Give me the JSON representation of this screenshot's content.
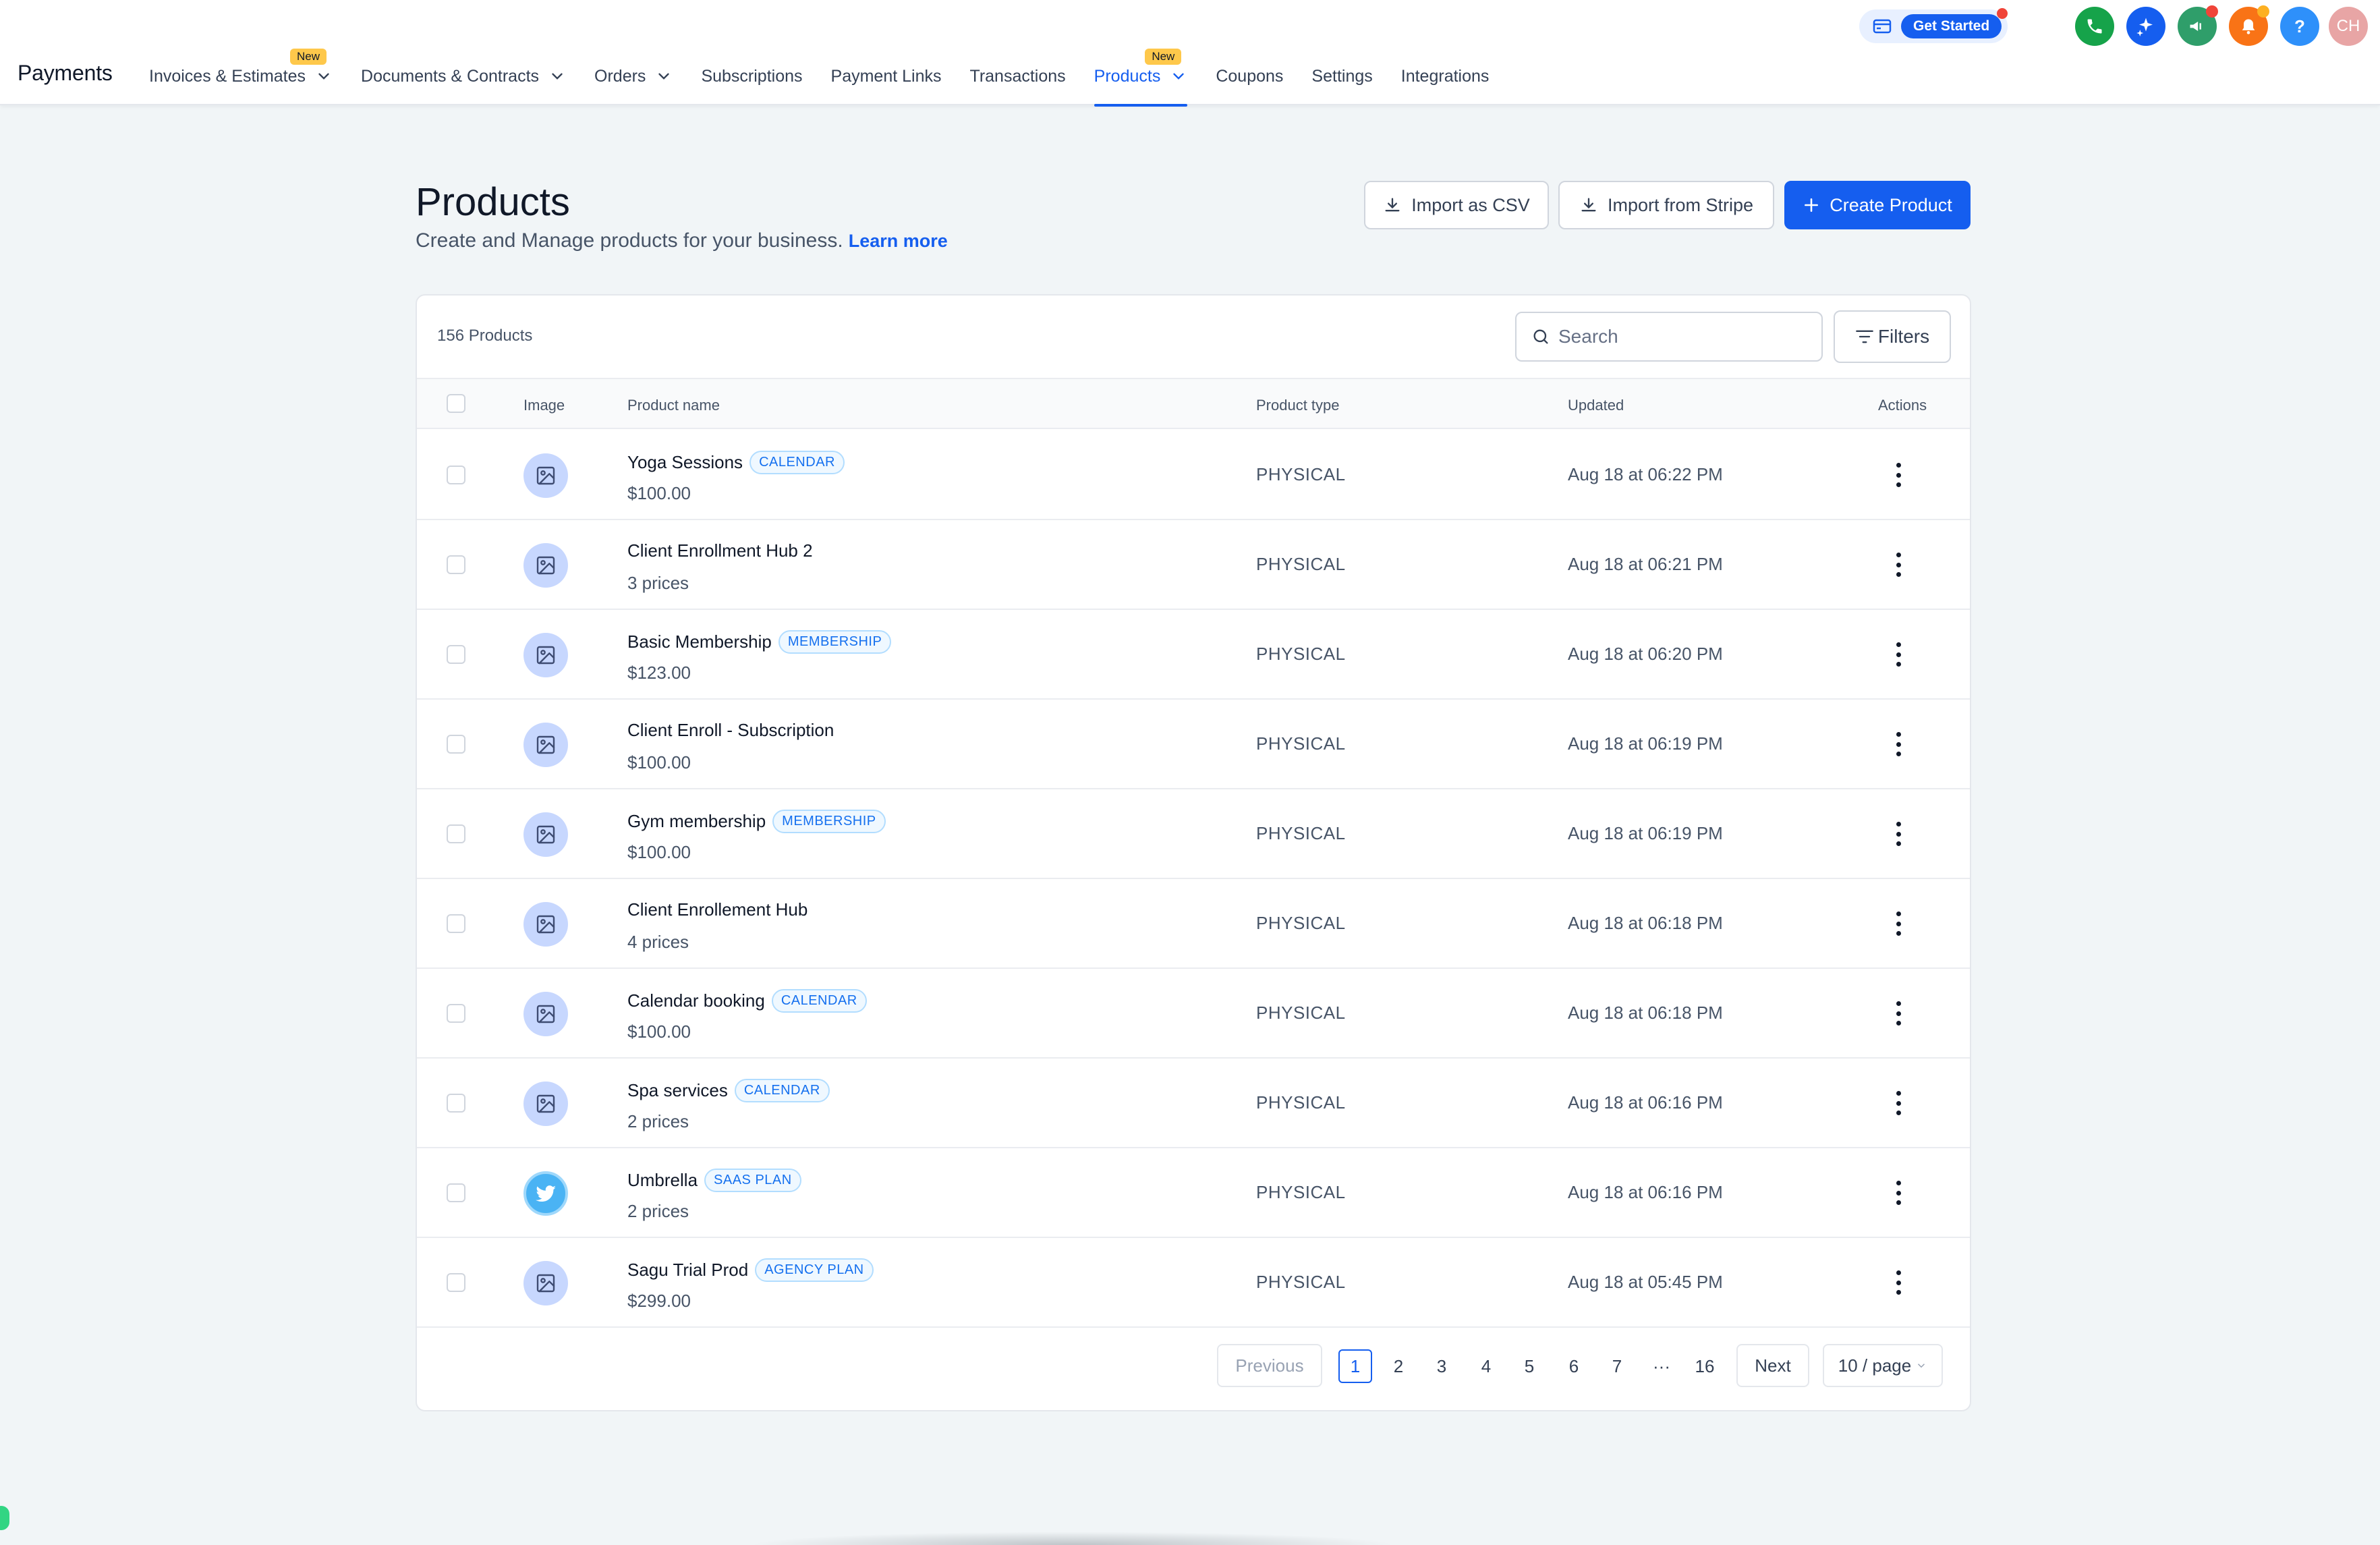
{
  "app": {
    "brand": "Payments",
    "nav": [
      {
        "label": "Invoices & Estimates",
        "badge": "New",
        "dropdown": true,
        "active": false
      },
      {
        "label": "Documents & Contracts",
        "badge": "",
        "dropdown": true,
        "active": false
      },
      {
        "label": "Orders",
        "badge": "",
        "dropdown": true,
        "active": false
      },
      {
        "label": "Subscriptions",
        "badge": "",
        "dropdown": false,
        "active": false
      },
      {
        "label": "Payment Links",
        "badge": "",
        "dropdown": false,
        "active": false
      },
      {
        "label": "Transactions",
        "badge": "",
        "dropdown": false,
        "active": false
      },
      {
        "label": "Products",
        "badge": "New",
        "dropdown": true,
        "active": true
      },
      {
        "label": "Coupons",
        "badge": "",
        "dropdown": false,
        "active": false
      },
      {
        "label": "Settings",
        "badge": "",
        "dropdown": false,
        "active": false
      },
      {
        "label": "Integrations",
        "badge": "",
        "dropdown": false,
        "active": false
      }
    ],
    "get_started": "Get Started",
    "top_icons": [
      {
        "name": "phone-icon",
        "color": "#16a34a"
      },
      {
        "name": "sparkle-icon",
        "color": "#155eef"
      },
      {
        "name": "megaphone-icon",
        "color": "#2f9e6a"
      },
      {
        "name": "bell-icon",
        "color": "#f97316"
      },
      {
        "name": "help-icon",
        "color": "#2e90fa",
        "glyph": "?"
      },
      {
        "name": "avatar",
        "color": "#e8a5a5",
        "glyph": "CH"
      }
    ]
  },
  "header": {
    "title": "Products",
    "subtitle": "Create and Manage products for your business.",
    "learn_more": "Learn more",
    "import_csv": "Import as CSV",
    "import_stripe": "Import from Stripe",
    "create": "Create Product"
  },
  "table": {
    "count": "156 Products",
    "search_placeholder": "Search",
    "filters": "Filters",
    "columns": [
      "Image",
      "Product name",
      "Product type",
      "Updated",
      "Actions"
    ],
    "rows": [
      {
        "name": "Yoga Sessions",
        "tag": "CALENDAR",
        "price": "$100.00",
        "type": "PHYSICAL",
        "updated": "Aug 18 at 06:22 PM",
        "image": "placeholder"
      },
      {
        "name": "Client Enrollment Hub 2",
        "tag": "",
        "price": "3 prices",
        "type": "PHYSICAL",
        "updated": "Aug 18 at 06:21 PM",
        "image": "placeholder"
      },
      {
        "name": "Basic Membership",
        "tag": "MEMBERSHIP",
        "price": "$123.00",
        "type": "PHYSICAL",
        "updated": "Aug 18 at 06:20 PM",
        "image": "placeholder"
      },
      {
        "name": "Client Enroll  - Subscription",
        "tag": "",
        "price": "$100.00",
        "type": "PHYSICAL",
        "updated": "Aug 18 at 06:19 PM",
        "image": "placeholder"
      },
      {
        "name": "Gym membership",
        "tag": "MEMBERSHIP",
        "price": "$100.00",
        "type": "PHYSICAL",
        "updated": "Aug 18 at 06:19 PM",
        "image": "placeholder"
      },
      {
        "name": "Client Enrollement Hub",
        "tag": "",
        "price": "4 prices",
        "type": "PHYSICAL",
        "updated": "Aug 18 at 06:18 PM",
        "image": "placeholder"
      },
      {
        "name": "Calendar booking",
        "tag": "CALENDAR",
        "price": "$100.00",
        "type": "PHYSICAL",
        "updated": "Aug 18 at 06:18 PM",
        "image": "placeholder"
      },
      {
        "name": "Spa services",
        "tag": "CALENDAR",
        "price": "2 prices",
        "type": "PHYSICAL",
        "updated": "Aug 18 at 06:16 PM",
        "image": "placeholder"
      },
      {
        "name": "Umbrella",
        "tag": "SAAS PLAN",
        "price": "2 prices",
        "type": "PHYSICAL",
        "updated": "Aug 18 at 06:16 PM",
        "image": "bird"
      },
      {
        "name": "Sagu Trial Prod",
        "tag": "AGENCY PLAN",
        "price": "$299.00",
        "type": "PHYSICAL",
        "updated": "Aug 18 at 05:45 PM",
        "image": "placeholder"
      }
    ]
  },
  "pagination": {
    "previous": "Previous",
    "pages": [
      "1",
      "2",
      "3",
      "4",
      "5",
      "6",
      "7",
      "···",
      "16"
    ],
    "current": "1",
    "next": "Next",
    "per_page": "10 / page"
  },
  "colors": {
    "accent": "#155eef",
    "tag": "#1570ef",
    "background": "#f1f5f7"
  }
}
